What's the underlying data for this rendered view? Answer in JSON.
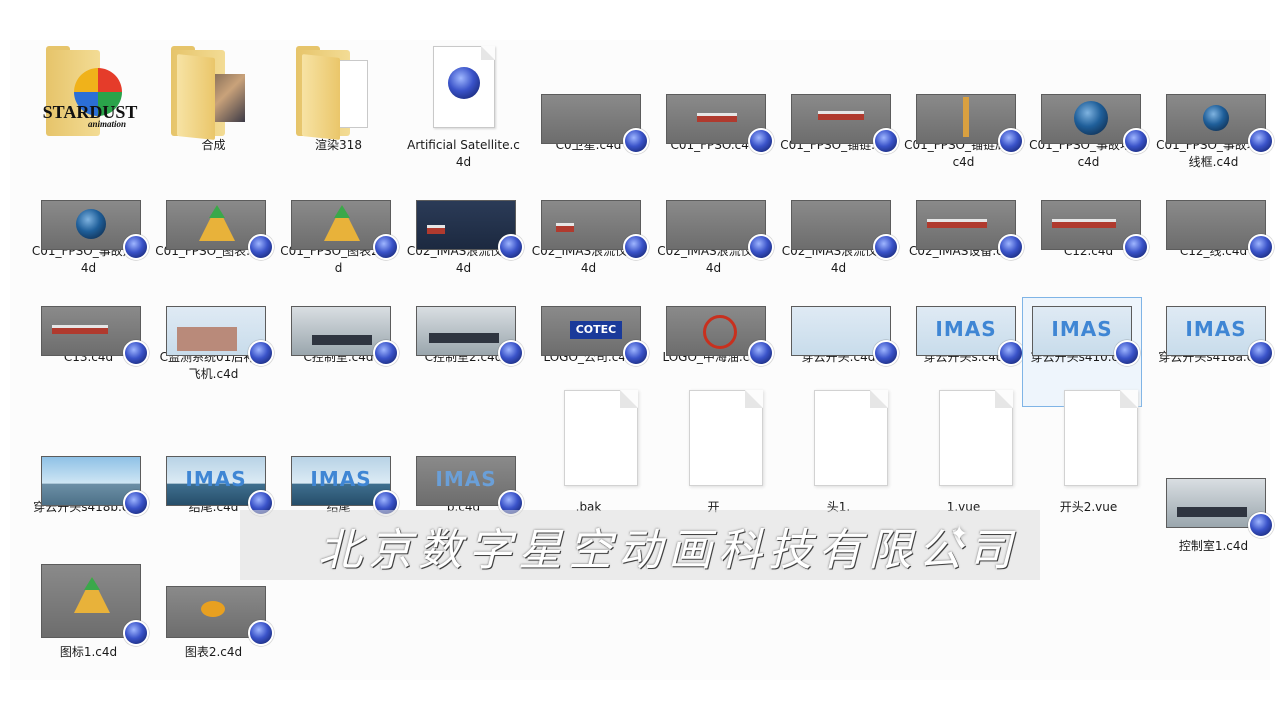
{
  "items": [
    {
      "label": "",
      "kind": "folder-stardust"
    },
    {
      "label": "合成",
      "kind": "folder-photo"
    },
    {
      "label": "渲染318",
      "kind": "folder-paper"
    },
    {
      "label": "Artificial Satellite.c4d",
      "kind": "c4d-doc"
    },
    {
      "label": "C0卫星.c4d",
      "kind": "c4d",
      "theme": "grey"
    },
    {
      "label": "C01_FPSO.c4d",
      "kind": "c4d",
      "theme": "grey"
    },
    {
      "label": "C01_FPSO_锚链.c4d",
      "kind": "c4d",
      "theme": "grey"
    },
    {
      "label": "C01_FPSO_锚链局部.c4d",
      "kind": "c4d",
      "theme": "grey"
    },
    {
      "label": "C01_FPSO_事故地球.c4d",
      "kind": "c4d",
      "theme": "grey"
    },
    {
      "label": "C01_FPSO_事故地球线框.c4d",
      "kind": "c4d",
      "theme": "grey"
    },
    {
      "label": "C01_FPSO_事故点.c4d",
      "kind": "c4d",
      "theme": "grey"
    },
    {
      "label": "C01_FPSO_图表.c4d",
      "kind": "c4d",
      "theme": "grey"
    },
    {
      "label": "C01_FPSO_图表2.c4d",
      "kind": "c4d",
      "theme": "grey"
    },
    {
      "label": "C02_IMAS浪流仪a.c4d",
      "kind": "c4d",
      "theme": "dark"
    },
    {
      "label": "C02_IMAS浪流仪b.c4d",
      "kind": "c4d",
      "theme": "grey"
    },
    {
      "label": "C02_IMAS浪流仪c.c4d",
      "kind": "c4d",
      "theme": "grey"
    },
    {
      "label": "C02_IMAS浪流仪d.c4d",
      "kind": "c4d",
      "theme": "grey"
    },
    {
      "label": "C02_IMAS设备.c4d",
      "kind": "c4d",
      "theme": "grey"
    },
    {
      "label": "C12.c4d",
      "kind": "c4d",
      "theme": "grey"
    },
    {
      "label": "C12_线.c4d",
      "kind": "c4d",
      "theme": "grey"
    },
    {
      "label": "C13.c4d",
      "kind": "c4d",
      "theme": "grey"
    },
    {
      "label": "C监测系统01后补换飞机.c4d",
      "kind": "c4d",
      "theme": "light"
    },
    {
      "label": "C控制室.c4d",
      "kind": "c4d",
      "theme": "room"
    },
    {
      "label": "C控制室2.c4d",
      "kind": "c4d",
      "theme": "room"
    },
    {
      "label": "LOGO_公司.c4d",
      "kind": "c4d",
      "theme": "grey"
    },
    {
      "label": "LOGO_中海油.c4d",
      "kind": "c4d",
      "theme": "grey"
    },
    {
      "label": "穿云开头.c4d",
      "kind": "c4d",
      "theme": "light"
    },
    {
      "label": "穿云开头s.c4d",
      "kind": "c4d",
      "theme": "light"
    },
    {
      "label": "穿云开头s410.c4d",
      "kind": "c4d",
      "theme": "light"
    },
    {
      "label": "穿云开头s418a.c4d",
      "kind": "c4d",
      "theme": "light"
    },
    {
      "label": "穿云开头s418b.c4d",
      "kind": "c4d",
      "theme": "sea"
    },
    {
      "label": "结尾.c4d",
      "kind": "c4d",
      "theme": "ship-sea"
    },
    {
      "label": "结尾",
      "kind": "c4d",
      "theme": "ship-sea"
    },
    {
      "label": "b.c4d",
      "kind": "c4d",
      "theme": "grey"
    },
    {
      "label": ".bak",
      "kind": "blank"
    },
    {
      "label": "开",
      "kind": "blank"
    },
    {
      "label": "头1.",
      "kind": "blank"
    },
    {
      "label": "1.vue",
      "kind": "blank"
    },
    {
      "label": "开头2.vue",
      "kind": "blank"
    },
    {
      "label": "控制室1.c4d",
      "kind": "c4d",
      "theme": "room"
    },
    {
      "label": "图标1.c4d",
      "kind": "c4d",
      "theme": "grey"
    },
    {
      "label": "图表2.c4d",
      "kind": "c4d",
      "theme": "grey"
    }
  ],
  "stardust": {
    "name": "STARDUST",
    "sub": "animation"
  },
  "thumb_text": {
    "imas": "IMAS",
    "cotec": "COTEC"
  },
  "watermark": {
    "text": "北京数字星空动画科技有限公司"
  }
}
